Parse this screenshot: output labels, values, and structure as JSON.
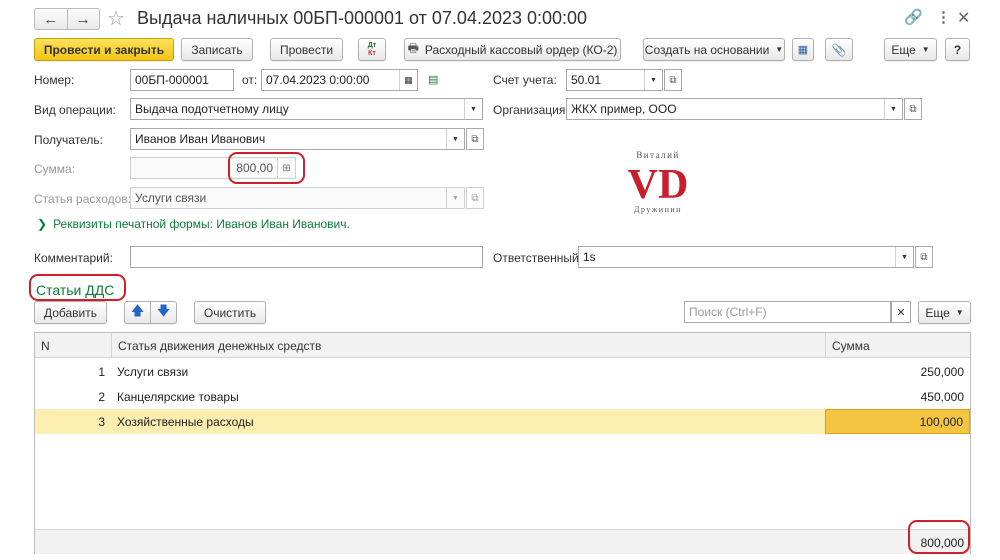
{
  "window": {
    "title": "Выдача наличных 00БП-000001 от 07.04.2023 0:00:00",
    "nav_back_icon": "arrow-left-icon",
    "nav_forward_icon": "arrow-right-icon",
    "favorite_icon": "star-icon",
    "link_icon": "link-icon",
    "menu_icon": "more-vertical-icon",
    "close_icon": "close-icon"
  },
  "toolbar": {
    "post_and_close": "Провести и закрыть",
    "save": "Записать",
    "post": "Провести",
    "dt_kt_top": "Дт",
    "dt_kt_bottom": "Кт",
    "print_order": "Расходный кассовый ордер (КО-2)",
    "create_based_on": "Создать на основании",
    "more": "Еще",
    "help": "?"
  },
  "form": {
    "number_label": "Номер:",
    "number_value": "00БП-000001",
    "date_label": "от:",
    "date_value": "07.04.2023  0:00:00",
    "account_label": "Счет учета:",
    "account_value": "50.01",
    "operation_label": "Вид операции:",
    "operation_value": "Выдача подотчетному лицу",
    "org_label": "Организация:",
    "org_value": "ЖКХ пример, ООО",
    "recipient_label": "Получатель:",
    "recipient_value": "Иванов Иван Иванович",
    "sum_label": "Сумма:",
    "sum_value": "800,00",
    "expense_label": "Статья расходов:",
    "expense_value": "Услуги связи",
    "print_details_link": "Реквизиты печатной формы: Иванов Иван Иванович.",
    "comment_label": "Комментарий:",
    "comment_value": "",
    "responsible_label": "Ответственный:",
    "responsible_value": "1s"
  },
  "logo": {
    "top_text": "Виталий",
    "mark": "VD",
    "bottom_text": "Дружинин"
  },
  "dds_section": {
    "title": "Статьи ДДС",
    "add_button": "Добавить",
    "clear_button": "Очистить",
    "search_placeholder": "Поиск (Ctrl+F)",
    "more": "Еще",
    "columns": {
      "n": "N",
      "item": "Статья движения денежных средств",
      "sum": "Сумма"
    },
    "rows": [
      {
        "n": "1",
        "item": "Услуги связи",
        "sum": "250,000"
      },
      {
        "n": "2",
        "item": "Канцелярские товары",
        "sum": "450,000"
      },
      {
        "n": "3",
        "item": "Хозяйственные расходы",
        "sum": "100,000"
      }
    ],
    "total": "800,000"
  },
  "colors": {
    "accent_yellow": "#f3c417",
    "link_green": "#0e7a3a",
    "highlight_red": "#cf1f2a",
    "selected_row": "#fbeeb0"
  }
}
